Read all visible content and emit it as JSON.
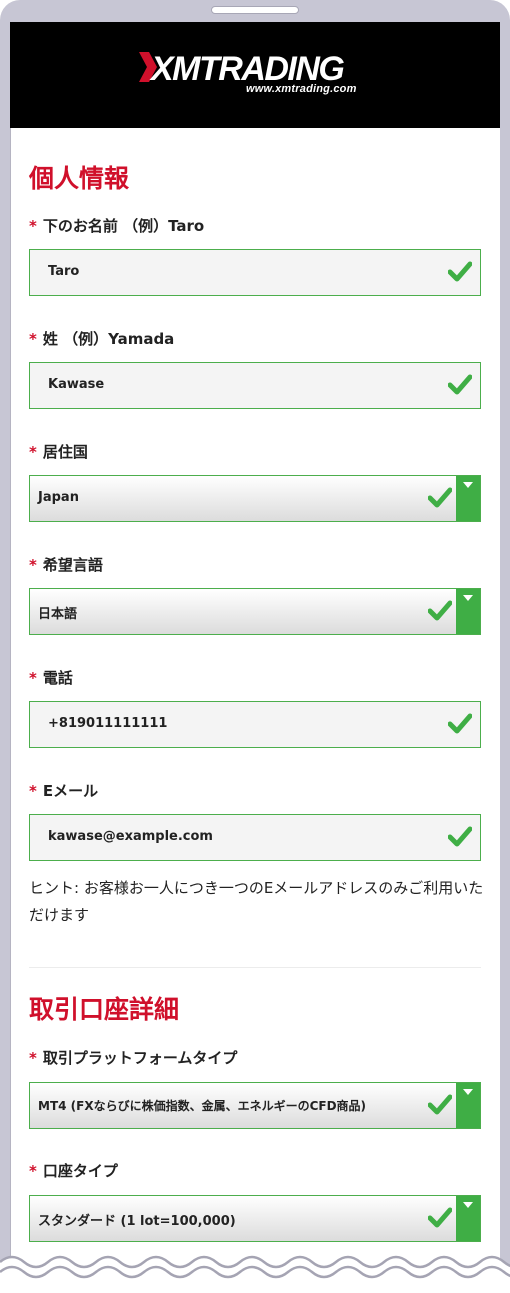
{
  "brand": {
    "logo_text": "XMTRADING",
    "url": "www.xmtrading.com"
  },
  "colors": {
    "accent_red": "#d0102b",
    "valid_green": "#3fae45",
    "header_bg": "#000000"
  },
  "personal": {
    "title": "個人情報",
    "first_name": {
      "label": "下のお名前 （例）Taro",
      "value": "Taro"
    },
    "last_name": {
      "label": "姓 （例）Yamada",
      "value": "Kawase"
    },
    "country": {
      "label": "居住国",
      "value": "Japan"
    },
    "language": {
      "label": "希望言語",
      "value": "日本語"
    },
    "phone": {
      "label": "電話",
      "value": "+819011111111"
    },
    "email": {
      "label": "Eメール",
      "value": "kawase@example.com",
      "hint": "ヒント: お客様お一人につき一つのEメールアドレスのみご利用いただけます"
    }
  },
  "account": {
    "title": "取引口座詳細",
    "platform": {
      "label": "取引プラットフォームタイプ",
      "value": "MT4 (FXならびに株価指数、金属、エネルギーのCFD商品)"
    },
    "account_type": {
      "label": "口座タイプ",
      "value": "スタンダード (1 lot=100,000)"
    }
  },
  "required_marker": "*",
  "icons": {
    "valid": "checkmark-icon",
    "dropdown": "caret-down-icon"
  }
}
